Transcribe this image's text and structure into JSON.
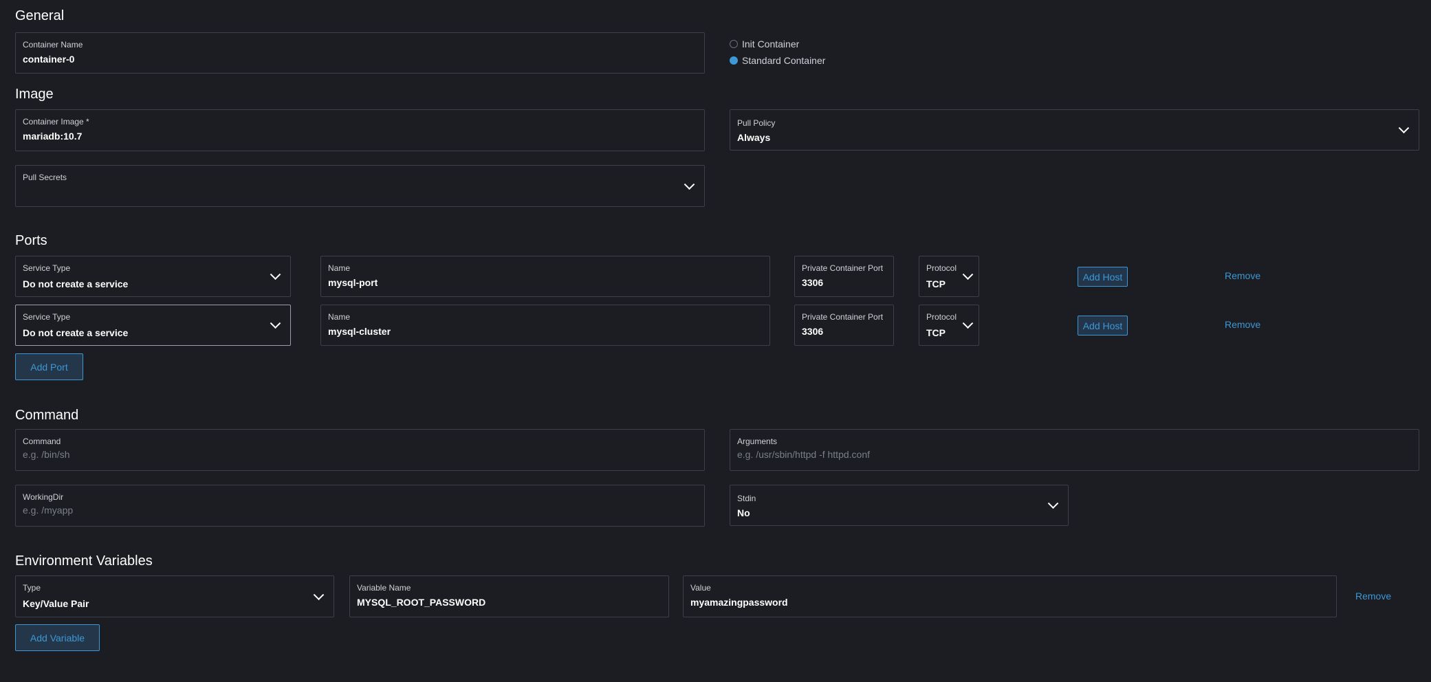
{
  "general": {
    "title": "General",
    "container_name": {
      "label": "Container Name",
      "value": "container-0"
    },
    "container_type": {
      "options": [
        {
          "label": "Init Container",
          "checked": false
        },
        {
          "label": "Standard Container",
          "checked": true
        }
      ]
    }
  },
  "image": {
    "title": "Image",
    "container_image": {
      "label": "Container Image *",
      "value": "mariadb:10.7"
    },
    "pull_policy": {
      "label": "Pull Policy",
      "value": "Always"
    },
    "pull_secrets": {
      "label": "Pull Secrets",
      "value": ""
    }
  },
  "ports": {
    "title": "Ports",
    "rows": [
      {
        "service_type_label": "Service Type",
        "service_type": "Do not create a service",
        "name_label": "Name",
        "name": "mysql-port",
        "port_label": "Private Container Port",
        "port": "3306",
        "protocol_label": "Protocol",
        "protocol": "TCP",
        "add_host": "Add Host",
        "remove": "Remove"
      },
      {
        "service_type_label": "Service Type",
        "service_type": "Do not create a service",
        "name_label": "Name",
        "name": "mysql-cluster",
        "port_label": "Private Container Port",
        "port": "3306",
        "protocol_label": "Protocol",
        "protocol": "TCP",
        "add_host": "Add Host",
        "remove": "Remove"
      }
    ],
    "add_port": "Add Port"
  },
  "command": {
    "title": "Command",
    "command": {
      "label": "Command",
      "placeholder": "e.g. /bin/sh"
    },
    "arguments": {
      "label": "Arguments",
      "placeholder": "e.g. /usr/sbin/httpd -f httpd.conf"
    },
    "working_dir": {
      "label": "WorkingDir",
      "placeholder": "e.g. /myapp"
    },
    "stdin": {
      "label": "Stdin",
      "value": "No"
    }
  },
  "env": {
    "title": "Environment Variables",
    "rows": [
      {
        "type_label": "Type",
        "type": "Key/Value Pair",
        "var_name_label": "Variable Name",
        "var_name": "MYSQL_ROOT_PASSWORD",
        "value_label": "Value",
        "value": "myamazingpassword",
        "remove": "Remove"
      }
    ],
    "add_variable": "Add Variable"
  },
  "colors": {
    "background": "#1b1d22",
    "border": "#3d4048",
    "accent": "#3d98d3",
    "text": "#ffffff"
  }
}
